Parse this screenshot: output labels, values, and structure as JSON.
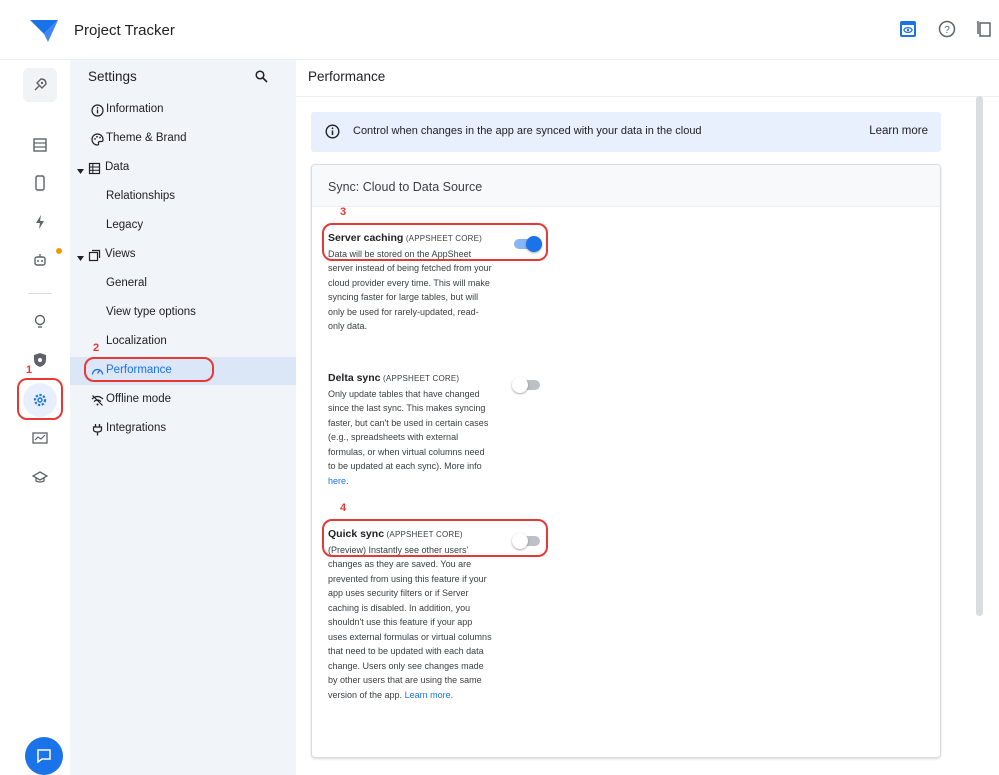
{
  "app": {
    "title": "Project Tracker"
  },
  "settings_panel": {
    "title": "Settings",
    "items": [
      {
        "label": "Information",
        "icon": "info-icon"
      },
      {
        "label": "Theme & Brand",
        "icon": "palette-icon"
      },
      {
        "label": "Data",
        "icon": "table-icon"
      },
      {
        "label": "Relationships",
        "icon": ""
      },
      {
        "label": "Legacy",
        "icon": ""
      },
      {
        "label": "Views",
        "icon": "views-icon"
      },
      {
        "label": "General",
        "icon": ""
      },
      {
        "label": "View type options",
        "icon": ""
      },
      {
        "label": "Localization",
        "icon": ""
      },
      {
        "label": "Performance",
        "icon": "speed-icon"
      },
      {
        "label": "Offline mode",
        "icon": "wifi-off-icon"
      },
      {
        "label": "Integrations",
        "icon": "plug-icon"
      }
    ]
  },
  "main": {
    "title": "Performance",
    "banner": {
      "text": "Control when changes in the app are synced with your data in the cloud",
      "link": "Learn more"
    },
    "card": {
      "title": "Sync: Cloud to Data Source",
      "settings": [
        {
          "name": "Server caching",
          "tag": "(APPSHEET CORE)",
          "description": "Data will be stored on the AppSheet server instead of being fetched from your cloud provider every time. This will make syncing faster for large tables, but will only be used for rarely-updated, read-only data.",
          "enabled": true
        },
        {
          "name": "Delta sync",
          "tag": "(APPSHEET CORE)",
          "description": "Only update tables that have changed since the last sync. This makes syncing faster, but can't be used in certain cases (e.g., spreadsheets with external formulas, or when virtual columns need to be updated at each sync). More info",
          "link": "here",
          "suffix": ".",
          "enabled": false
        },
        {
          "name": "Quick sync",
          "tag": "(APPSHEET CORE)",
          "description": "(Preview) Instantly see other users' changes as they are saved. You are prevented from using this feature if your app uses security filters or if Server caching is disabled. In addition, you shouldn't use this feature if your app uses external formulas or virtual columns that need to be updated with each data change. Users only see changes made by other users that are using the same version of the app.",
          "link": "Learn more",
          "suffix": ".",
          "enabled": false
        }
      ]
    }
  },
  "annotations": [
    "1",
    "2",
    "3",
    "4"
  ],
  "colors": {
    "accent": "#1a73e8",
    "callout": "#e53935",
    "panel_bg": "#f1f4f9",
    "active_bg": "#dbe6f6"
  }
}
